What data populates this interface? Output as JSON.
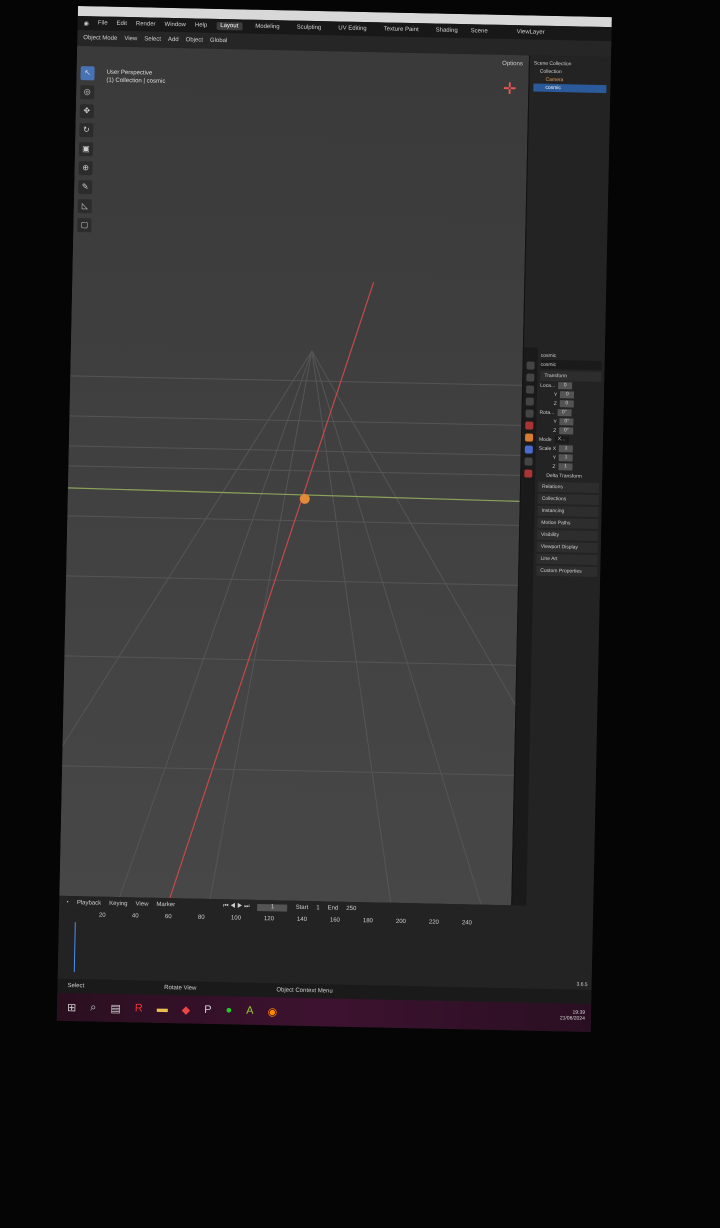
{
  "menu": [
    "File",
    "Edit",
    "Render",
    "Window",
    "Help"
  ],
  "workspaces": [
    {
      "label": "Layout",
      "active": true
    },
    {
      "label": "Modeling"
    },
    {
      "label": "Sculpting"
    },
    {
      "label": "UV Editing"
    },
    {
      "label": "Texture Paint"
    },
    {
      "label": "Shading"
    }
  ],
  "header": {
    "mode": "Object Mode",
    "view": "View",
    "select": "Select",
    "add": "Add",
    "object": "Object",
    "transform": "Global",
    "scene": "Scene",
    "viewlayer": "ViewLayer",
    "options": "Options"
  },
  "viewport": {
    "perspective": "User Perspective",
    "collection": "(1) Collection | cosmic"
  },
  "outliner": {
    "rows": [
      "Scene Collection",
      "Collection",
      "Camera",
      "cosmic"
    ]
  },
  "properties": {
    "object": "cosmic",
    "data": "cosmic",
    "transform": "Transform",
    "location_label": "Loca...",
    "rotation_label": "Rota...",
    "mode_label": "Mode",
    "mode_value": "X...",
    "scale_label": "Scale X",
    "axes": [
      "Y",
      "Z"
    ],
    "location": [
      "0",
      "0",
      "0"
    ],
    "rotation": [
      "0°",
      "0°",
      "0°"
    ],
    "scale": [
      "1",
      "1",
      "1"
    ],
    "delta": "Delta Transform",
    "panels": [
      "Relations",
      "Collections",
      "Instancing",
      "Motion Paths",
      "Visibility",
      "Viewport Display",
      "Line Art",
      "Custom Properties"
    ]
  },
  "timeline": {
    "playback": "Playback",
    "keying": "Keying",
    "view": "View",
    "marker": "Marker",
    "current": "1",
    "start_label": "Start",
    "start": "1",
    "end_label": "End",
    "end": "250",
    "ticks": [
      "20",
      "40",
      "60",
      "80",
      "100",
      "120",
      "140",
      "160",
      "180",
      "200",
      "220",
      "240"
    ]
  },
  "status": {
    "select": "Select",
    "rotate": "Rotate View",
    "context": "Object Context Menu",
    "version": "3.6.5"
  },
  "clock": {
    "time": "19:39",
    "date": "21/06/2024"
  }
}
